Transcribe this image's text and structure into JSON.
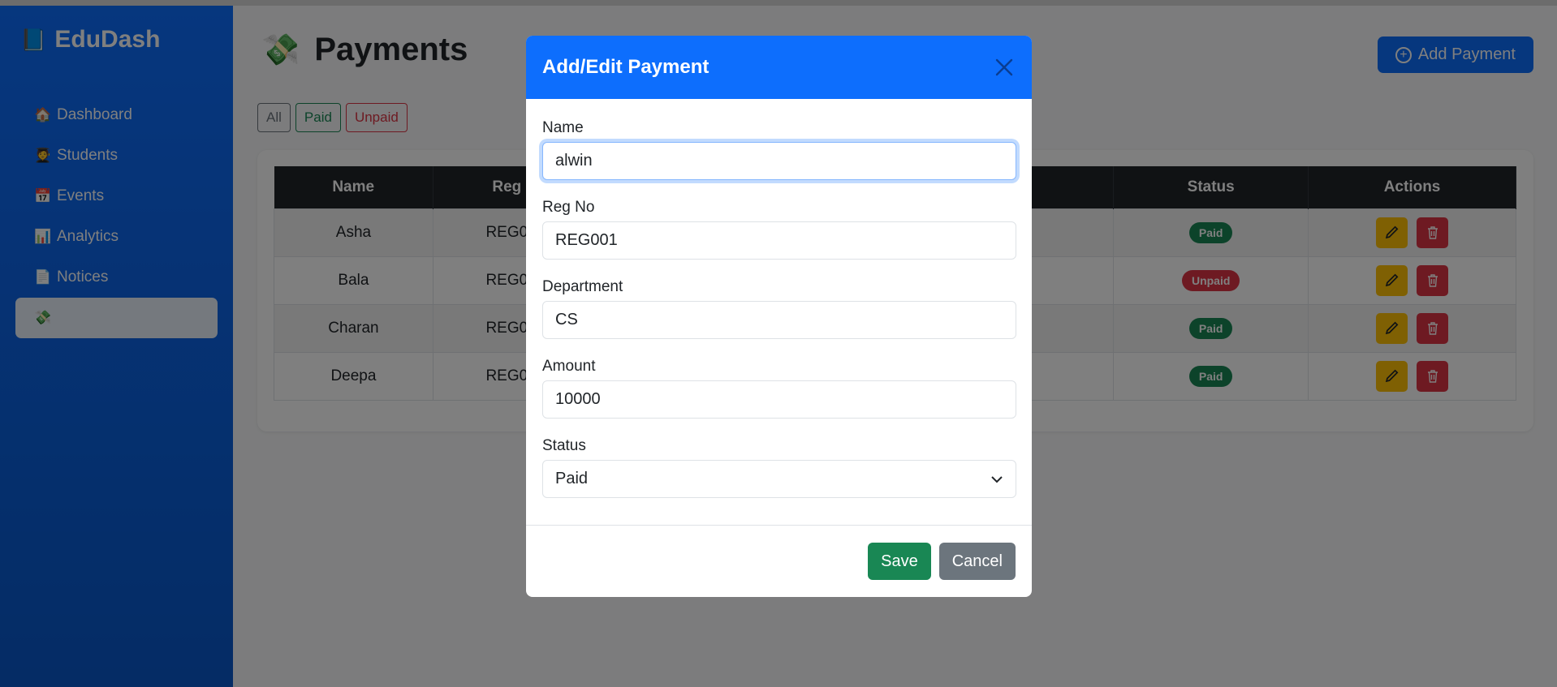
{
  "app": {
    "brand": "EduDash"
  },
  "sidebar": {
    "items": [
      {
        "label": "Dashboard",
        "icon": "house-icon"
      },
      {
        "label": "Students",
        "icon": "student-icon"
      },
      {
        "label": "Events",
        "icon": "calendar-icon"
      },
      {
        "label": "Analytics",
        "icon": "chart-icon"
      },
      {
        "label": "Notices",
        "icon": "notice-icon"
      },
      {
        "label": "",
        "icon": "money-icon",
        "active": true
      }
    ]
  },
  "page": {
    "title": "Payments",
    "add_button": "Add Payment",
    "filters": {
      "all": "All",
      "paid": "Paid",
      "unpaid": "Unpaid"
    }
  },
  "table": {
    "headers": {
      "name": "Name",
      "reg": "Reg",
      "status": "Status",
      "actions": "Actions"
    },
    "rows": [
      {
        "name": "Asha",
        "reg": "REG0",
        "status": "Paid"
      },
      {
        "name": "Bala",
        "reg": "REG0",
        "status": "Unpaid"
      },
      {
        "name": "Charan",
        "reg": "REG0",
        "status": "Paid"
      },
      {
        "name": "Deepa",
        "reg": "REG0",
        "status": "Paid"
      }
    ]
  },
  "modal": {
    "title": "Add/Edit Payment",
    "fields": {
      "name": {
        "label": "Name",
        "value": "alwin"
      },
      "reg_no": {
        "label": "Reg No",
        "value": "REG001"
      },
      "department": {
        "label": "Department",
        "value": "CS"
      },
      "amount": {
        "label": "Amount",
        "value": "10000"
      },
      "status": {
        "label": "Status",
        "value": "Paid"
      }
    },
    "save": "Save",
    "cancel": "Cancel"
  },
  "colors": {
    "primary": "#0d6efd",
    "success": "#198754",
    "danger": "#dc3545",
    "warning": "#ffc107",
    "secondary": "#6c757d"
  }
}
